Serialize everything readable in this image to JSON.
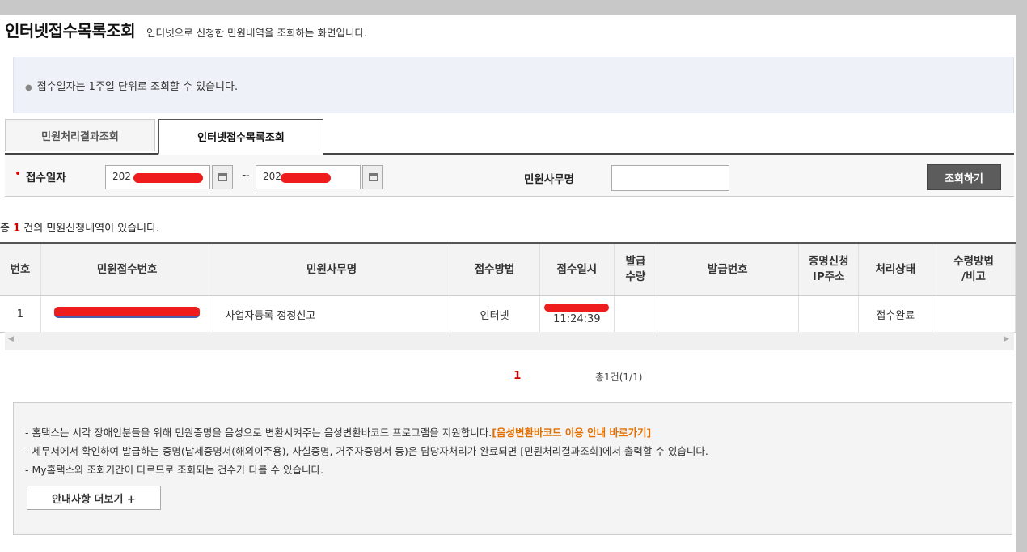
{
  "header": {
    "title": "인터넷접수목록조회",
    "subtitle": "인터넷으로 신청한 민원내역을 조회하는 화면입니다."
  },
  "notice": {
    "text": "접수일자는 1주일 단위로 조회할 수 있습니다."
  },
  "tabs": [
    {
      "label": "민원처리결과조회",
      "active": false
    },
    {
      "label": "인터넷접수목록조회",
      "active": true
    }
  ],
  "search": {
    "date_label": "접수일자",
    "date_from": "202",
    "date_to": "202",
    "tilde": "~",
    "service_label": "민원사무명",
    "service_value": "",
    "button_label": "조회하기"
  },
  "result": {
    "prefix": "총",
    "count": "1",
    "suffix": "건의 민원신청내역이 있습니다."
  },
  "table": {
    "headers": [
      "번호",
      "민원접수번호",
      "민원사무명",
      "접수방법",
      "접수일시",
      "발급\n수량",
      "발급번호",
      "증명신청\nIP주소",
      "처리상태",
      "수령방법\n/비고"
    ],
    "rows": [
      {
        "no": "1",
        "receipt_no": "",
        "service": "사업자등록 정정신고",
        "method": "인터넷",
        "time": "11:24:39",
        "qty": "",
        "issue_no": "",
        "ip": "",
        "status": "접수완료",
        "note": ""
      }
    ]
  },
  "pager": {
    "current": "1",
    "total": "총1건(1/1)"
  },
  "info": {
    "line1": "- 홈택스는 시각 장애인분들을 위해 민원증명을 음성으로 변환시켜주는 음성변환바코드 프로그램을 지원합니다.",
    "line1_link": "[음성변환바코드 이용 안내 바로가기]",
    "line2": "- 세무서에서 확인하여 발급하는 증명(납세증명서(해외이주용), 사실증명, 거주자증명서 등)은 담당자처리가 완료되면 [민원처리결과조회]에서 출력할 수 있습니다.",
    "line3": "- My홈택스와 조회기간이 다르므로 조회되는 건수가 다를 수 있습니다.",
    "more_button": "안내사항 더보기 +"
  },
  "colors": {
    "accent_red": "#ee1c1c",
    "link_orange": "#e07000",
    "button_dark": "#5c5c5c"
  }
}
